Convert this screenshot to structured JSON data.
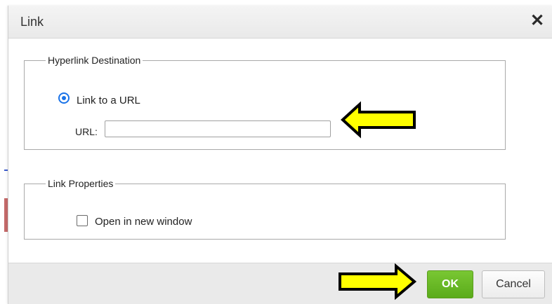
{
  "dialog": {
    "title": "Link",
    "close_glyph": "✕"
  },
  "destination": {
    "legend": "Hyperlink Destination",
    "radio_label": "Link to a URL",
    "radio_checked": true,
    "url_label": "URL:",
    "url_value": "",
    "url_placeholder": ""
  },
  "properties": {
    "legend": "Link Properties",
    "checkbox_label": "Open in new window",
    "checkbox_checked": false
  },
  "footer": {
    "ok_label": "OK",
    "cancel_label": "Cancel"
  },
  "colors": {
    "ok_button": "#5aab1a",
    "radio_accent": "#1a73e8",
    "annotation_arrow_fill": "#ffff00",
    "annotation_arrow_stroke": "#000000"
  },
  "icons": {
    "close": "close-icon",
    "annotation": "arrow-annotation-icon"
  }
}
